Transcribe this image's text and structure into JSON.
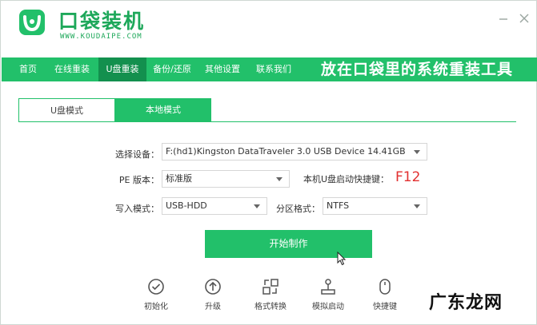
{
  "app": {
    "brand": "口袋装机",
    "brand_sub": "WWW.KOUDAIPE.COM",
    "minimize_icon": "minimize-icon",
    "close_icon": "close-icon"
  },
  "nav": {
    "items": [
      {
        "label": "首页"
      },
      {
        "label": "在线重装"
      },
      {
        "label": "U盘重装",
        "active": true
      },
      {
        "label": "备份/还原"
      },
      {
        "label": "其他设置"
      },
      {
        "label": "联系我们"
      }
    ],
    "slogan": "放在口袋里的系统重装工具"
  },
  "tabs": [
    {
      "label": "U盘模式",
      "active": true
    },
    {
      "label": "本地模式",
      "active": false
    }
  ],
  "form": {
    "device_label": "选择设备：",
    "device_value": "F:(hd1)Kingston DataTraveler 3.0 USB Device 14.41GB",
    "pe_label": "PE 版本：",
    "pe_value": "标准版",
    "hotkey_label": "本机U盘启动快捷键：",
    "hotkey_value": "F12",
    "write_label": "写入模式：",
    "write_value": "USB-HDD",
    "partition_label": "分区格式：",
    "partition_value": "NTFS"
  },
  "start_button": "开始制作",
  "tools": [
    {
      "label": "初始化",
      "icon": "check-circle-icon"
    },
    {
      "label": "升级",
      "icon": "arrow-up-circle-icon"
    },
    {
      "label": "格式转换",
      "icon": "convert-icon"
    },
    {
      "label": "模拟启动",
      "icon": "joystick-icon"
    },
    {
      "label": "快捷键",
      "icon": "mouse-icon"
    }
  ],
  "watermark": "广东龙网",
  "colors": {
    "accent": "#22c06a",
    "accent_dark": "#13904e",
    "brand": "#1ea85a",
    "hotkey": "#e23030"
  }
}
